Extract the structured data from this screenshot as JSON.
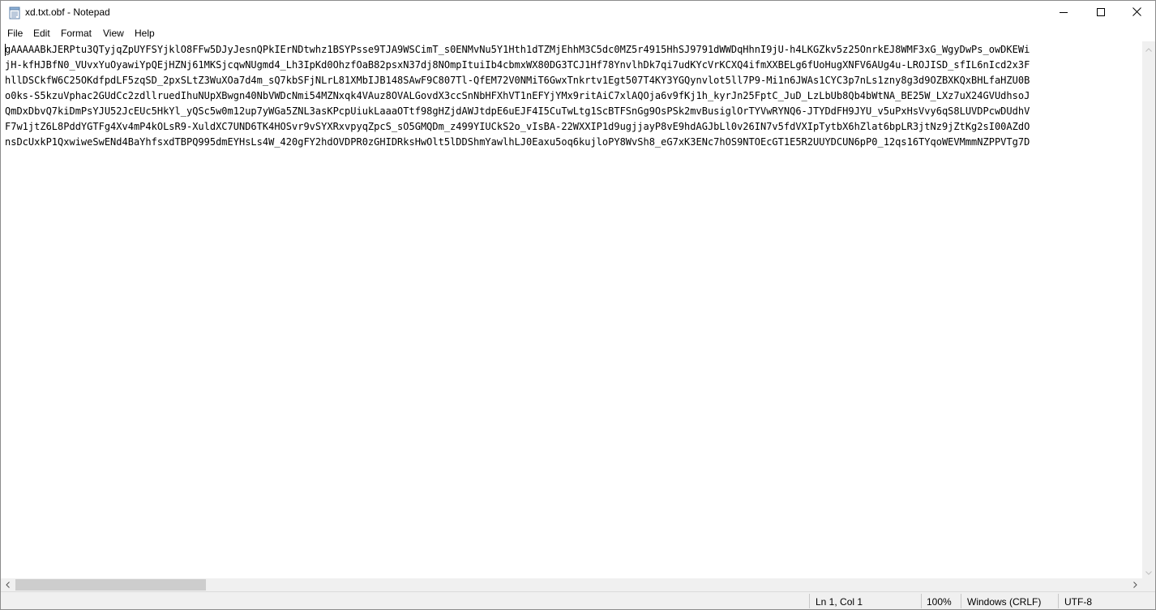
{
  "window": {
    "title": "xd.txt.obf - Notepad"
  },
  "menu": {
    "file": "File",
    "edit": "Edit",
    "format": "Format",
    "view": "View",
    "help": "Help"
  },
  "editor": {
    "lines": [
      "gAAAAABkJERPtu3QTyjqZpUYFSYjklO8FFw5DJyJesnQPkIErNDtwhz1BSYPsse9TJA9WSCimT_s0ENMvNu5Y1Hth1dTZMjEhhM3C5dc0MZ5r4915HhSJ9791dWWDqHhnI9jU-h4LKGZkv5z25OnrkEJ8WMF3xG_WgyDwPs_owDKEWi",
      "jH-kfHJBfN0_VUvxYuOyawiYpQEjHZNj61MKSjcqwNUgmd4_Lh3IpKd0OhzfOaB82psxN37dj8NOmpItuiIb4cbmxWX80DG3TCJ1Hf78YnvlhDk7qi7udKYcVrKCXQ4ifmXXBELg6fUoHugXNFV6AUg4u-LROJISD_sfIL6nIcd2x3F",
      "hllDSCkfW6C25OKdfpdLF5zqSD_2pxSLtZ3WuXOa7d4m_sQ7kbSFjNLrL81XMbIJB148SAwF9C807Tl-QfEM72V0NMiT6GwxTnkrtv1Egt507T4KY3YGQynvlot5ll7P9-Mi1n6JWAs1CYC3p7nLs1zny8g3d9OZBXKQxBHLfaHZU0B",
      "o0ks-S5kzuVphac2GUdCc2zdllruedIhuNUpXBwgn40NbVWDcNmi54MZNxqk4VAuz8OVALGovdX3ccSnNbHFXhVT1nEFYjYMx9ritAiC7xlAQOja6v9fKj1h_kyrJn25FptC_JuD_LzLbUb8Qb4bWtNA_BE25W_LXz7uX24GVUdhsoJ",
      "QmDxDbvQ7kiDmPsYJU52JcEUc5HkYl_yQSc5w0m12up7yWGa5ZNL3asKPcpUiukLaaaOTtf98gHZjdAWJtdpE6uEJF4I5CuTwLtg1ScBTFSnGg9OsPSk2mvBusiglOrTYVwRYNQ6-JTYDdFH9JYU_v5uPxHsVvy6qS8LUVDPcwDUdhV",
      "F7w1jtZ6L8PddYGTFg4Xv4mP4kOLsR9-XuldXC7UND6TK4HOSvr9vSYXRxvpyqZpcS_sO5GMQDm_z499YIUCkS2o_vIsBA-22WXXIP1d9ugjjayP8vE9hdAGJbLl0v26IN7v5fdVXIpTytbX6hZlat6bpLR3jtNz9jZtKg2sI00AZdO",
      "nsDcUxkP1QxwiweSwENd4BaYhfsxdTBPQ995dmEYHsLs4W_420gFY2hdOVDPR0zGHIDRksHwOlt5lDDShmYawlhLJ0Eaxu5oq6kujloPY8WvSh8_eG7xK3ENc7hOS9NTOEcGT1E5R2UUYDCUN6pP0_12qs16TYqoWEVMmmNZPPVTg7D"
    ]
  },
  "status": {
    "position": "Ln 1, Col 1",
    "zoom": "100%",
    "line_ending": "Windows (CRLF)",
    "encoding": "UTF-8"
  },
  "icons": {
    "app": "notepad-icon",
    "minimize": "minimize-icon",
    "maximize": "maximize-icon",
    "close": "close-icon"
  }
}
